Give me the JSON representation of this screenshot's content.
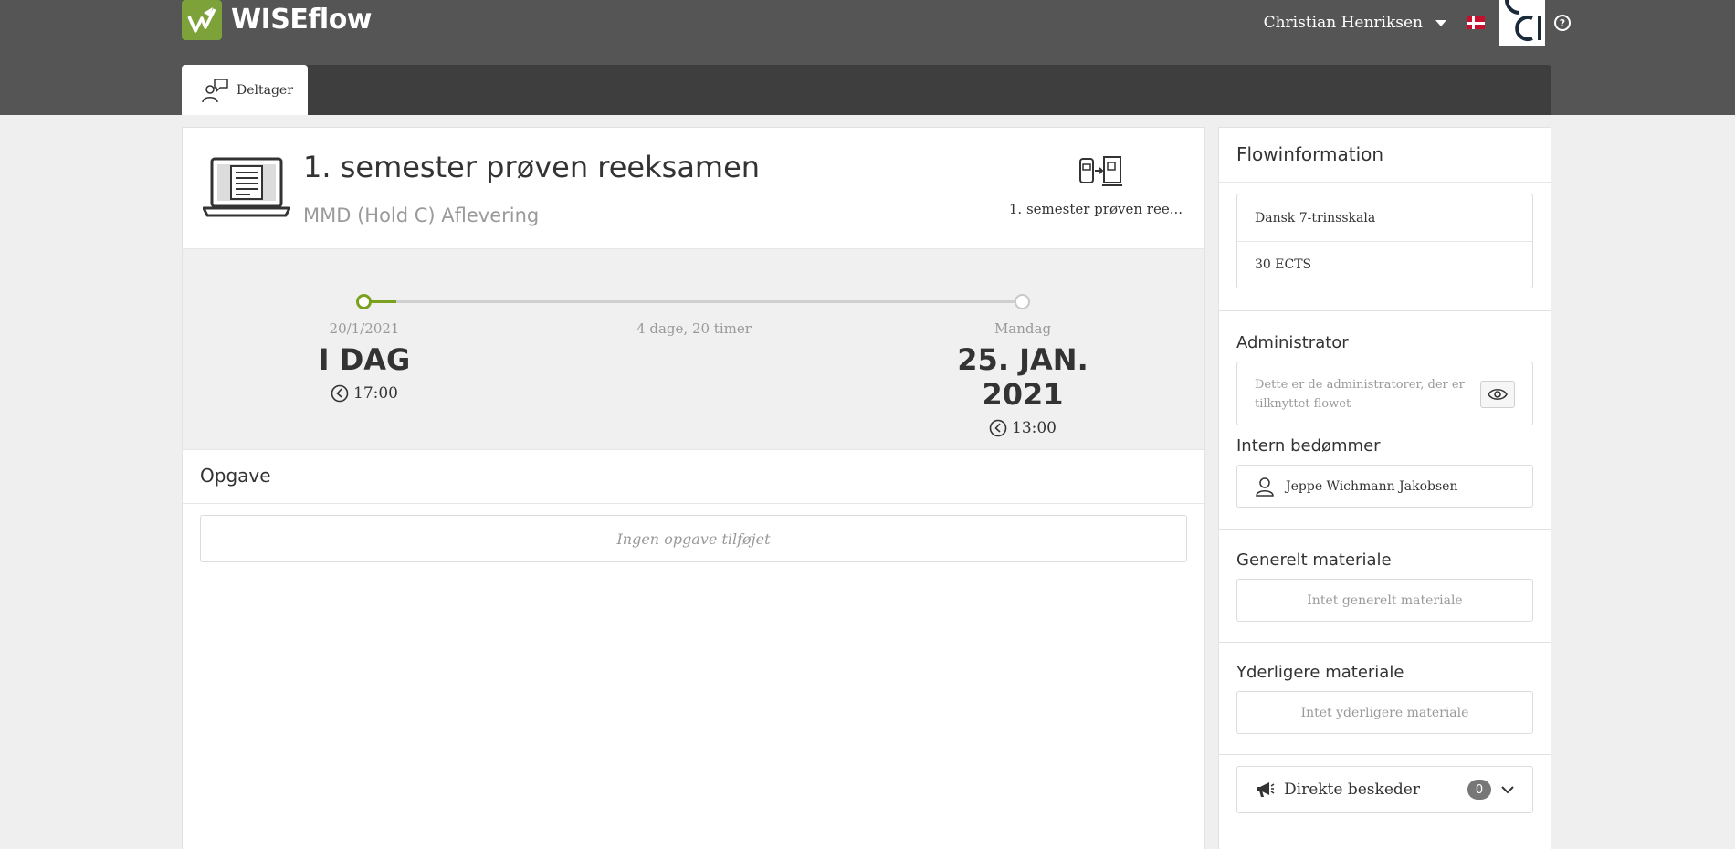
{
  "header": {
    "brand": "WISEflow",
    "user_name": "Christian Henriksen"
  },
  "tabs": [
    {
      "label": "Deltager",
      "active": true
    }
  ],
  "flow": {
    "title": "1. semester prøven reeksamen",
    "subtitle": "MMD (Hold C) Aflevering",
    "reference": "1. semester prøven ree..."
  },
  "timeline": {
    "progress": 0.05,
    "start": {
      "date": "20/1/2021",
      "label": "I DAG",
      "time": "17:00"
    },
    "duration": "4 dage, 20 timer",
    "end": {
      "date": "Mandag",
      "label": "25. JAN. 2021",
      "time": "13:00"
    }
  },
  "assignment": {
    "heading": "Opgave",
    "empty_text": "Ingen opgave tilføjet"
  },
  "sidebar": {
    "heading": "Flowinformation",
    "info_rows": [
      "Dansk 7-trinsskala",
      "30 ECTS"
    ],
    "administrator": {
      "title": "Administrator",
      "text": "Dette er de administratorer, der er tilknyttet flowet"
    },
    "assessor": {
      "title": "Intern bedømmer",
      "name": "Jeppe Wichmann Jakobsen"
    },
    "general_material": {
      "title": "Generelt materiale",
      "empty_text": "Intet generelt materiale"
    },
    "additional_material": {
      "title": "Yderligere materiale",
      "empty_text": "Intet yderligere materiale"
    },
    "messages": {
      "label": "Direkte beskeder",
      "count": "0"
    }
  },
  "colors": {
    "header_bg": "#555555",
    "tabbar_bg": "#3e3e3e",
    "brand_green": "#7da23a",
    "progress_green": "#7aa01d"
  },
  "icons": [
    "wiseflow-logo-icon",
    "caret-down-icon",
    "danish-flag-icon",
    "organization-logo-icon",
    "help-icon",
    "participant-icon",
    "laptop-document-icon",
    "flow-reference-icon",
    "clock-icon",
    "eye-icon",
    "user-icon",
    "megaphone-icon",
    "chevron-down-icon"
  ]
}
